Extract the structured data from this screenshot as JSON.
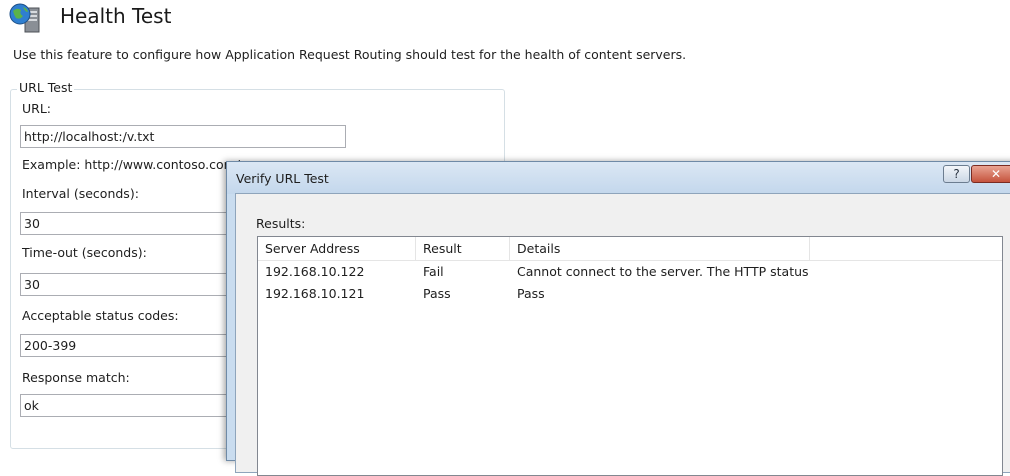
{
  "header": {
    "title": "Health Test",
    "description": "Use this feature to configure how Application Request Routing should test for the health of content servers."
  },
  "url_test": {
    "group_label": "URL Test",
    "url_label": "URL:",
    "url_value": "http://localhost:/v.txt",
    "example_text": "Example: http://www.contoso.com/",
    "interval_label": "Interval (seconds):",
    "interval_value": "30",
    "timeout_label": "Time-out (seconds):",
    "timeout_value": "30",
    "status_codes_label": "Acceptable status codes:",
    "status_codes_value": "200-399",
    "response_match_label": "Response match:",
    "response_match_value": "ok"
  },
  "dialog": {
    "title": "Verify URL Test",
    "help_glyph": "?",
    "close_glyph": "✕",
    "results_label": "Results:",
    "columns": [
      "Server Address",
      "Result",
      "Details"
    ],
    "rows": [
      {
        "address": "192.168.10.122",
        "result": "Fail",
        "details": "Cannot connect to the server. The HTTP status c..."
      },
      {
        "address": "192.168.10.121",
        "result": "Pass",
        "details": "Pass"
      }
    ]
  },
  "icons": {
    "page_icon": "globe-server-icon"
  },
  "colors": {
    "dialog_frame": "#c9dcef",
    "close_button": "#c5533d"
  }
}
